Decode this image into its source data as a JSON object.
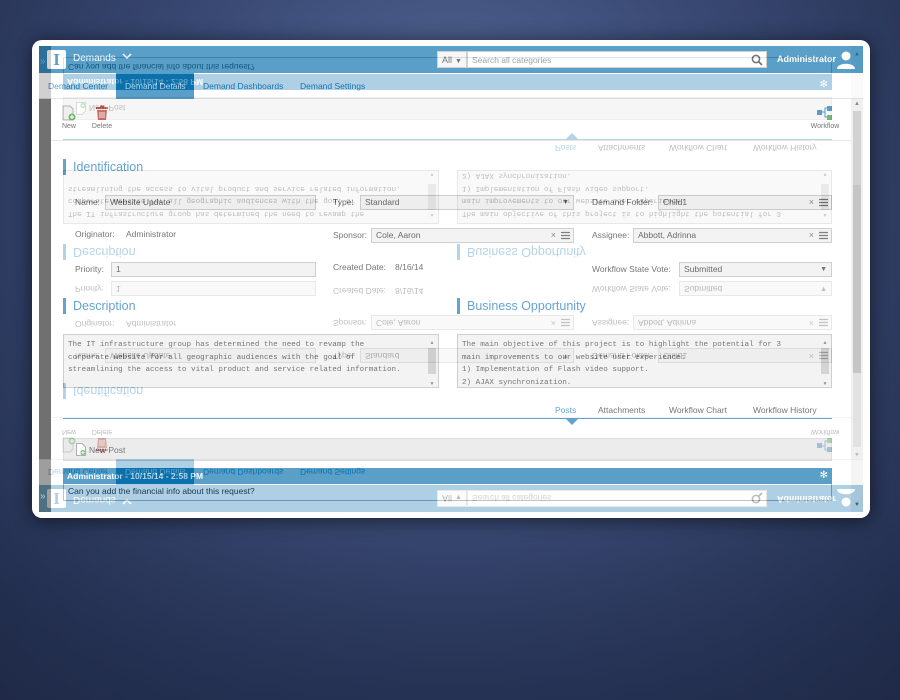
{
  "header": {
    "logo_letter": "I",
    "app_title": "Demands",
    "search_scope": "All",
    "search_placeholder": "Search all categories",
    "user_name": "Administrator"
  },
  "nav": {
    "tabs": [
      {
        "label": "Demand Center"
      },
      {
        "label": "Demand Details",
        "active": true
      },
      {
        "label": "Demand Dashboards"
      },
      {
        "label": "Demand Settings"
      }
    ]
  },
  "toolbar": {
    "new_label": "New",
    "delete_label": "Delete",
    "workflow_label": "Workflow"
  },
  "identification": {
    "title": "Identification",
    "name_label": "Name:",
    "name_value": "Website Update",
    "type_label": "Type:",
    "type_value": "Standard",
    "demand_folder_label": "Demand Folder:",
    "demand_folder_value": "Child1",
    "originator_label": "Originator:",
    "originator_value": "Administrator",
    "sponsor_label": "Sponsor:",
    "sponsor_value": "Cole, Aaron",
    "assignee_label": "Assignee:",
    "assignee_value": "Abbott, Adrinna",
    "priority_label": "Priority:",
    "priority_value": "1",
    "created_date_label": "Created Date:",
    "created_date_value": "8/16/14",
    "workflow_state_label": "Workflow State Vote:",
    "workflow_state_value": "Submitted"
  },
  "description": {
    "title": "Description",
    "lines": [
      "The IT infrastructure group has determined the need to revamp the",
      "corporate website for all geographic audiences with the goal of",
      "streamlining the access to vital product and service related information."
    ]
  },
  "business_opportunity": {
    "title": "Business Opportunity",
    "lines": [
      "The main objective of this project is to highlight the potential for 3",
      "main improvements to our website user experience:",
      "1) Implementation of Flash video support.",
      "2) AJAX synchronization."
    ]
  },
  "subtabs": {
    "posts": "Posts",
    "attachments": "Attachments",
    "workflow_chart": "Workflow Chart",
    "workflow_history": "Workflow History"
  },
  "posts": {
    "new_post_label": "New Post",
    "items": [
      {
        "header": "Administrator - 10/15/14 - 2:58 PM",
        "body": "Can you add the financial info about this request?"
      }
    ]
  },
  "colors": {
    "brand_blue": "#0a71ad",
    "link_blue": "#1a78b8",
    "delete_red": "#c0392b",
    "new_green": "#3aa63a"
  }
}
